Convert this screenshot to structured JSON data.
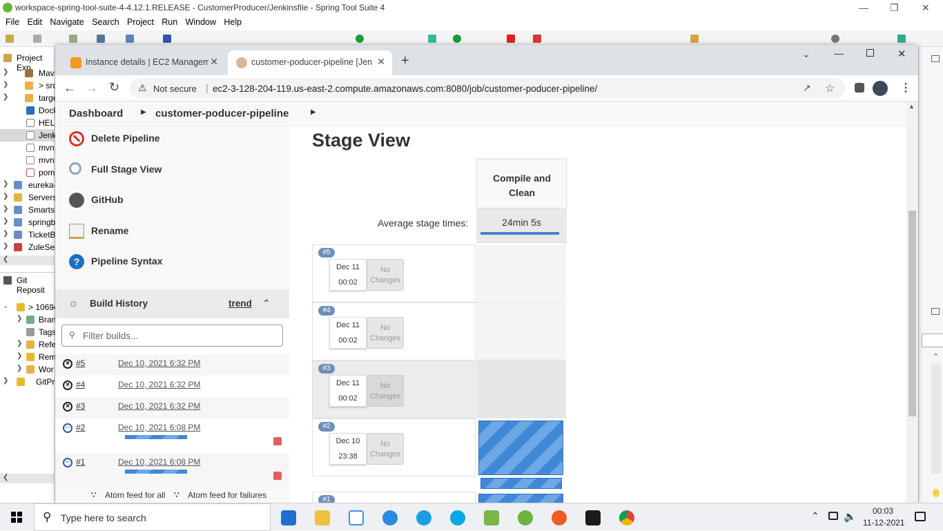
{
  "ide": {
    "title": "workspace-spring-tool-suite-4-4.12.1.RELEASE - CustomerProducer/Jenkinsfile - Spring Tool Suite 4",
    "menu": [
      "File",
      "Edit",
      "Navigate",
      "Search",
      "Project",
      "Run",
      "Window",
      "Help"
    ],
    "project_explorer_tab": "Project Exp",
    "tree": [
      {
        "label": "Mav",
        "icon": "library-icon"
      },
      {
        "label": "> src",
        "icon": "folder-icon"
      },
      {
        "label": "targe",
        "icon": "folder-icon"
      },
      {
        "label": "Dock",
        "icon": "docker-icon"
      },
      {
        "label": "HELI",
        "icon": "word-file-icon"
      },
      {
        "label": "Jenk",
        "icon": "file-icon"
      },
      {
        "label": "mvn",
        "icon": "file-icon"
      },
      {
        "label": "mvn",
        "icon": "file-icon"
      },
      {
        "label": "pom",
        "icon": "xml-file-icon"
      },
      {
        "label": "eureka-",
        "icon": "project-icon"
      },
      {
        "label": "Servers",
        "icon": "folder-icon"
      },
      {
        "label": "Smartsl",
        "icon": "project-icon"
      },
      {
        "label": "springb",
        "icon": "project-icon"
      },
      {
        "label": "TicketB",
        "icon": "project-icon"
      },
      {
        "label": "ZuleSer",
        "icon": "project-icon"
      }
    ],
    "git_tab": "Git Reposit",
    "git_tree": [
      {
        "label": "> 10694",
        "icon": "repo-icon"
      },
      {
        "label": "Bran",
        "icon": "branch-icon"
      },
      {
        "label": "Tags",
        "icon": "tag-icon"
      },
      {
        "label": "Refe",
        "icon": "folder-icon"
      },
      {
        "label": "Rem",
        "icon": "remote-icon"
      },
      {
        "label": "Wor",
        "icon": "folder-icon"
      },
      {
        "label": "GitPr",
        "icon": "repo-icon"
      }
    ]
  },
  "browser": {
    "tabs": [
      {
        "title": "Instance details | EC2 Manageme",
        "icon": "aws-icon"
      },
      {
        "title": "customer-poducer-pipeline [Jenk",
        "icon": "jenkins-icon"
      }
    ],
    "security": "Not secure",
    "url": "ec2-3-128-204-119.us-east-2.compute.amazonaws.com:8080/job/customer-poducer-pipeline/"
  },
  "jenkins": {
    "breadcrumb": [
      "Dashboard",
      "customer-poducer-pipeline"
    ],
    "tasks": [
      {
        "label": "Delete Pipeline",
        "icon": "delete-icon"
      },
      {
        "label": "Full Stage View",
        "icon": "magnifier-icon"
      },
      {
        "label": "GitHub",
        "icon": "github-icon"
      },
      {
        "label": "Rename",
        "icon": "rename-icon"
      },
      {
        "label": "Pipeline Syntax",
        "icon": "help-icon"
      }
    ],
    "build_history": {
      "title": "Build History",
      "trend": "trend",
      "filter_placeholder": "Filter builds...",
      "builds": [
        {
          "number": "#5",
          "date": "Dec 10, 2021 6:32 PM",
          "status": "aborted"
        },
        {
          "number": "#4",
          "date": "Dec 10, 2021 6:32 PM",
          "status": "aborted"
        },
        {
          "number": "#3",
          "date": "Dec 10, 2021 6:32 PM",
          "status": "aborted"
        },
        {
          "number": "#2",
          "date": "Dec 10, 2021 6:08 PM",
          "status": "running"
        },
        {
          "number": "#1",
          "date": "Dec 10, 2021 6:08 PM",
          "status": "running"
        }
      ],
      "feeds": [
        "Atom feed for all",
        "Atom feed for failures"
      ]
    },
    "stage_view": {
      "title": "Stage View",
      "stage_name": "Compile and Clean",
      "avg_label": "Average stage times:",
      "avg_time": "24min 5s",
      "runs": [
        {
          "badge": "#5",
          "date": "Dec 11",
          "time": "00:02",
          "changes": "No Changes"
        },
        {
          "badge": "#4",
          "date": "Dec 11",
          "time": "00:02",
          "changes": "No Changes"
        },
        {
          "badge": "#3",
          "date": "Dec 11",
          "time": "00:02",
          "changes": "No Changes"
        },
        {
          "badge": "#2",
          "date": "Dec 10",
          "time": "23:38",
          "changes": "No Changes"
        },
        {
          "badge": "#1"
        }
      ]
    }
  },
  "taskbar": {
    "search_placeholder": "Type here to search",
    "time": "00:03",
    "date": "11-12-2021"
  }
}
